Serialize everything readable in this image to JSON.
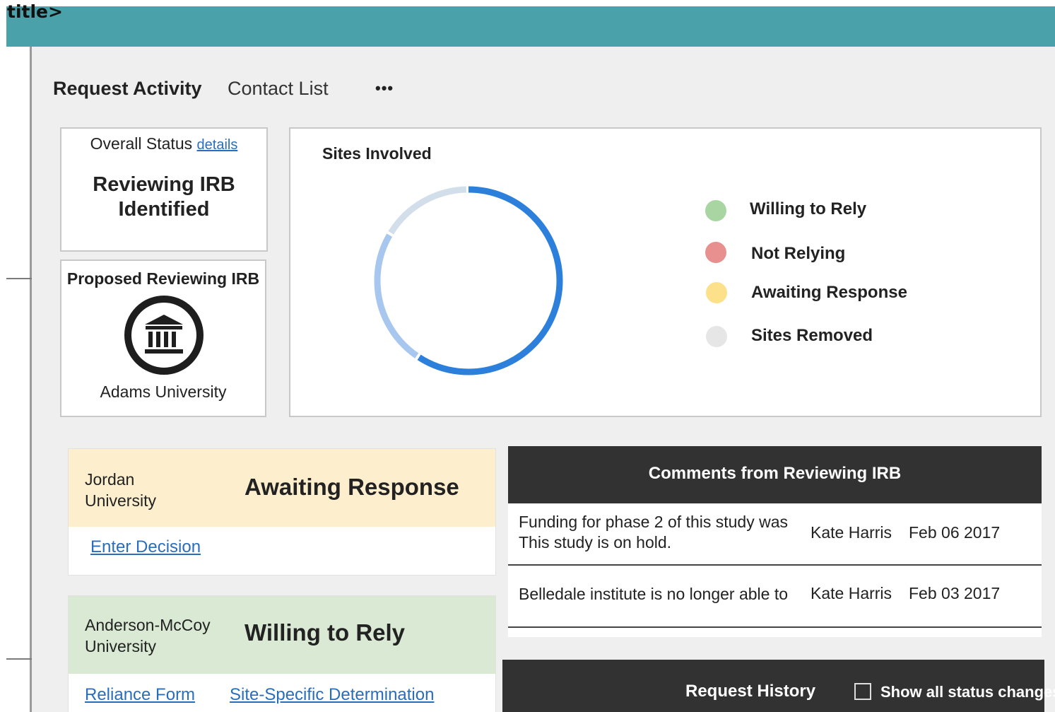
{
  "page": {
    "stray_title": "title>"
  },
  "tabs": [
    {
      "label": "Request Activity"
    },
    {
      "label": "Contact List"
    }
  ],
  "more_label": "•••",
  "overall_status": {
    "heading": "Overall Status",
    "details_link": "details",
    "value_line1": "Reviewing IRB",
    "value_line2": "Identified"
  },
  "proposed_irb": {
    "heading": "Proposed Reviewing IRB",
    "icon": "institution-icon",
    "name": "Adams University"
  },
  "sites_involved": {
    "title": "Sites Involved",
    "legend": [
      {
        "label": "Willing to Rely",
        "color": "#a8d5a2"
      },
      {
        "label": "Not Relying",
        "color": "#e89090"
      },
      {
        "label": "Awaiting Response",
        "color": "#fde08a"
      },
      {
        "label": "Sites Removed",
        "color": "#e6e6e6"
      }
    ],
    "donut_colors": {
      "primary": "#2c7fdb",
      "light": "#a7c7ef",
      "pale": "#d2dfea"
    }
  },
  "sites": [
    {
      "name_line1": "Jordan",
      "name_line2": "University",
      "status": "Awaiting Response",
      "color": "#fdefcd",
      "links": [
        "Enter Decision"
      ]
    },
    {
      "name_line1": "Anderson-McCoy",
      "name_line2": "University",
      "status": "Willing to Rely",
      "color": "#d9e9d3",
      "links": [
        "Reliance Form",
        "Site-Specific Determination"
      ]
    }
  ],
  "comments": {
    "title": "Comments from Reviewing IRB",
    "rows": [
      {
        "text_line1": "Funding for phase 2 of this study was",
        "text_line2": "This study is on hold.",
        "author": "Kate Harris",
        "date": "Feb 06 2017"
      },
      {
        "text_line1": "Belledale institute is no longer able to",
        "author": "Kate Harris",
        "date": "Feb 03 2017"
      }
    ]
  },
  "history": {
    "title": "Request History",
    "checkbox_label": "Show all status changes"
  }
}
